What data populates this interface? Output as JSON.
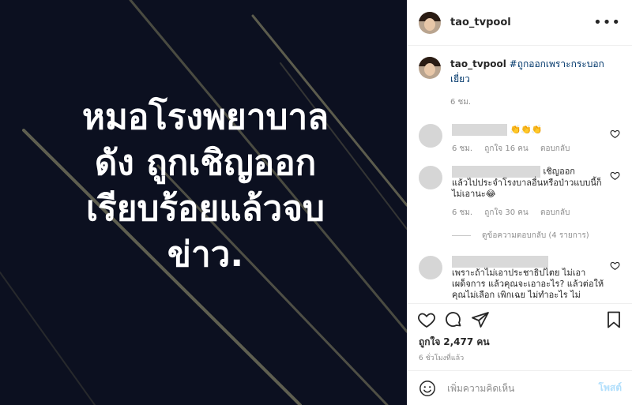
{
  "media": {
    "lines": [
      "หมอโรงพยาบาล",
      "ดัง ถูกเชิญออก",
      "เรียบร้อยแล้วจบ",
      "ข่าว."
    ]
  },
  "header": {
    "username": "tao_tvpool",
    "more": "•••"
  },
  "caption": {
    "username": "tao_tvpool",
    "hashtag": "#ถูกออกเพราะกระบอกเยี่ยว",
    "time": "6 ชม."
  },
  "comments": [
    {
      "emoji": "👏👏👏",
      "time": "6 ชม.",
      "likes": "ถูกใจ 16 คน",
      "reply": "ตอบกลับ"
    },
    {
      "text_line1": "เชิญออก",
      "text_rest": "แล้วไปประจำโรงบาลอื่นหรือป่าวแบบนี้ก็ไม่เอานะ😂",
      "time": "6 ชม.",
      "likes": "ถูกใจ 30 คน",
      "reply": "ตอบกลับ",
      "view_replies": "ดูข้อความตอบกลับ (4 รายการ)"
    },
    {
      "text": "เพราะถ้าไม่เอาประชาธิปไตย ไม่เอาเผด็จการ แล้วคุณจะเอาอะไร? แล้วต่อให้คุณไม่เลือก เพิกเฉย ไม่ทำอะไร ไม่"
    }
  ],
  "likes": {
    "label": "ถูกใจ",
    "count": "2,477 คน"
  },
  "time_ago": "6 ชั่วโมงที่แล้ว",
  "add_comment": {
    "placeholder": "เพิ่มความคิดเห็น",
    "post": "โพสต์"
  }
}
